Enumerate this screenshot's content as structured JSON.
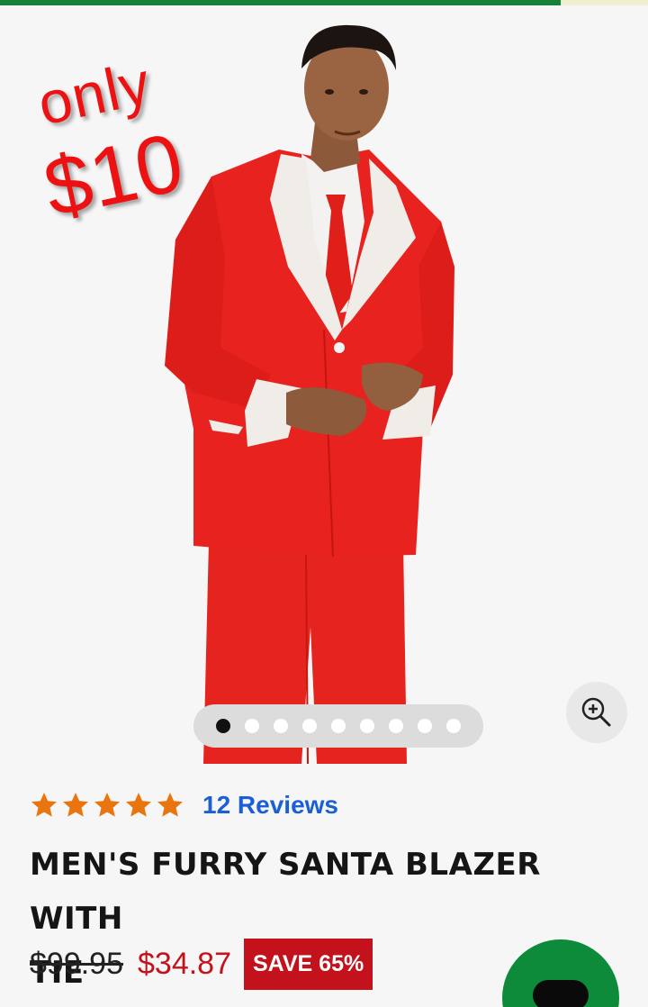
{
  "progress": {
    "fraction": 0.865,
    "fill_color": "#17803a",
    "track_color": "#f1efcf"
  },
  "promo": {
    "line1": "only",
    "line2": "$10",
    "color": "#ee1111"
  },
  "carousel": {
    "total_images": 9,
    "active_index": 0
  },
  "zoom": {
    "icon": "zoom-in-icon"
  },
  "product": {
    "rating": {
      "stars": 5,
      "max_stars": 5,
      "star_color": "#e8750f",
      "reviews_label": "12 Reviews"
    },
    "title_line1": "MEN'S FURRY SANTA BLAZER WITH",
    "title_line2": "TIE",
    "price_original": "$99.95",
    "price_sale": "$34.87",
    "save_badge": "SAVE 65%",
    "sale_color": "#c4121c"
  },
  "chat": {
    "icon": "chat-icon",
    "color": "#0e8a3b"
  }
}
